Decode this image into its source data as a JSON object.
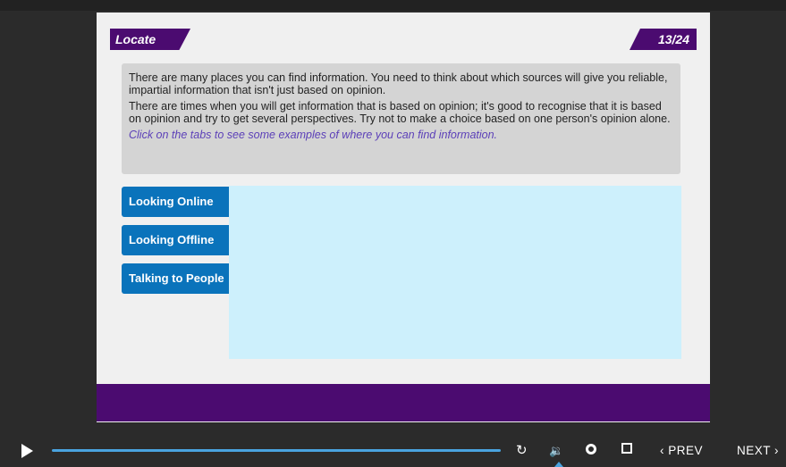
{
  "slide": {
    "title": "Locate",
    "page": "13/24",
    "paragraphs": [
      "There are many places you can find information. You need to think about which sources will give you reliable, impartial information that isn't just based on opinion.",
      "There are times when you will get information that is based on opinion; it's good to recognise that it is based on opinion and try to get several perspectives. Try not to make a choice based on one person's opinion alone."
    ],
    "hint": "Click on the tabs to see some examples of where you can find information.",
    "tabs": [
      {
        "label": "Looking Online"
      },
      {
        "label": "Looking Offline"
      },
      {
        "label": "Talking to People"
      }
    ]
  },
  "player": {
    "replay_icon": "↻",
    "volume_icon": "🔉",
    "prev_label": "‹ PREV",
    "next_label": "NEXT ›"
  },
  "colors": {
    "accent_purple": "#4b0b70",
    "tab_blue": "#0a73bb",
    "content_bg": "#cdf0fc",
    "progress_blue": "#4aa3df"
  }
}
